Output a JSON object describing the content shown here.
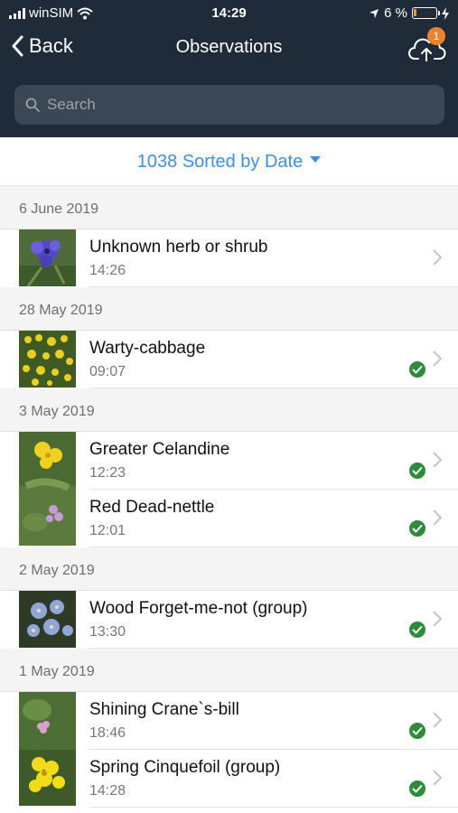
{
  "status": {
    "carrier": "winSIM",
    "time": "14:29",
    "battery": "6 %"
  },
  "nav": {
    "back_label": "Back",
    "title": "Observations",
    "upload_badge": "1"
  },
  "search": {
    "placeholder": "Search"
  },
  "sort": {
    "label": "1038 Sorted by Date"
  },
  "sections": [
    {
      "date": "6 June 2019",
      "thumb": "purple-flower",
      "items": [
        {
          "name": "Unknown herb or shrub",
          "time": "14:26",
          "verified": false
        }
      ]
    },
    {
      "date": "28 May 2019",
      "thumb": "yellow-cluster",
      "items": [
        {
          "name": "Warty-cabbage",
          "time": "09:07",
          "verified": true
        }
      ]
    },
    {
      "date": "3 May 2019",
      "thumb": "yellow-and-pink",
      "items": [
        {
          "name": "Greater Celandine",
          "time": "12:23",
          "verified": true
        },
        {
          "name": "Red Dead-nettle",
          "time": "12:01",
          "verified": true
        }
      ]
    },
    {
      "date": "2 May 2019",
      "thumb": "blue-forgetmenot",
      "items": [
        {
          "name": "Wood Forget-me-not (group)",
          "time": "13:30",
          "verified": true
        }
      ]
    },
    {
      "date": "1 May 2019",
      "thumb": "pink-and-yellow",
      "items": [
        {
          "name": "Shining Crane`s-bill",
          "time": "18:46",
          "verified": true
        },
        {
          "name": "Spring Cinquefoil (group)",
          "time": "14:28",
          "verified": true
        }
      ]
    }
  ],
  "colors": {
    "header_bg": "#1f2b38",
    "accent": "#3d8fe6",
    "check": "#2e8b3a",
    "badge": "#e8842f"
  }
}
